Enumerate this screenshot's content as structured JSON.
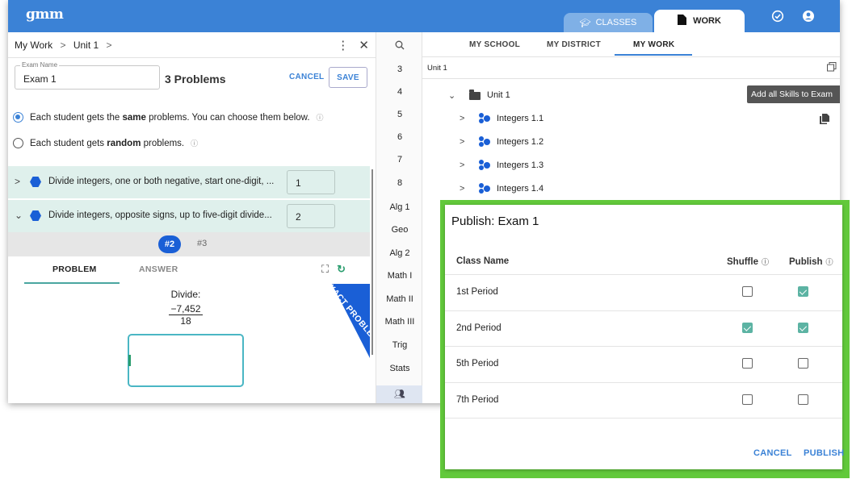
{
  "header": {
    "logo": "gmm",
    "tab_classes": "CLASSES",
    "tab_work": "WORK"
  },
  "left": {
    "breadcrumb": [
      "My Work",
      "Unit 1"
    ],
    "exam_name_label": "Exam Name",
    "exam_name_value": "Exam 1",
    "problem_count": "3 Problems",
    "cancel_label": "CANCEL",
    "save_label": "SAVE",
    "radio_same_pre": "Each student gets the ",
    "radio_same_bold": "same",
    "radio_same_post": " problems. You can choose them below.",
    "radio_random_pre": "Each student gets ",
    "radio_random_bold": "random",
    "radio_random_post": " problems.",
    "skills": [
      {
        "text": "Divide integers, one or both negative, start one-digit, ...",
        "qty": "1"
      },
      {
        "text": "Divide integers, opposite signs, up to five-digit divide...",
        "qty": "2"
      }
    ],
    "pages": [
      "#2",
      "#3"
    ],
    "tab_problem": "PROBLEM",
    "tab_answer": "ANSWER",
    "problem_prompt": "Divide:",
    "numerator": "−7,452",
    "denominator": "18",
    "banner_text": "EXACT PROBLEM"
  },
  "mid": {
    "items": [
      "3",
      "4",
      "5",
      "6",
      "7",
      "8",
      "Alg 1",
      "Geo",
      "Alg 2",
      "Math I",
      "Math II",
      "Math III",
      "Trig",
      "Stats"
    ]
  },
  "right": {
    "tabs": [
      "MY SCHOOL",
      "MY DISTRICT",
      "MY WORK"
    ],
    "active_tab": "MY WORK",
    "path": "Unit 1",
    "tooltip": "Add all Skills to Exam",
    "tree": [
      {
        "label": "Unit 1",
        "type": "folder"
      },
      {
        "label": "Integers 1.1",
        "type": "skill"
      },
      {
        "label": "Integers 1.2",
        "type": "skill"
      },
      {
        "label": "Integers 1.3",
        "type": "skill"
      },
      {
        "label": "Integers 1.4",
        "type": "skill"
      }
    ]
  },
  "dialog": {
    "title": "Publish: Exam 1",
    "col_class": "Class Name",
    "col_shuffle": "Shuffle",
    "col_publish": "Publish",
    "rows": [
      {
        "name": "1st Period",
        "shuffle": false,
        "publish": true
      },
      {
        "name": "2nd Period",
        "shuffle": true,
        "publish": true
      },
      {
        "name": "5th Period",
        "shuffle": false,
        "publish": false
      },
      {
        "name": "7th Period",
        "shuffle": false,
        "publish": false
      }
    ],
    "cancel": "CANCEL",
    "publish": "PUBLISH"
  },
  "colors": {
    "brand_blue": "#3b82d6",
    "skill_bg": "#dff0ec",
    "check_teal": "#5cb3a3",
    "highlight_green": "#62c93b"
  }
}
